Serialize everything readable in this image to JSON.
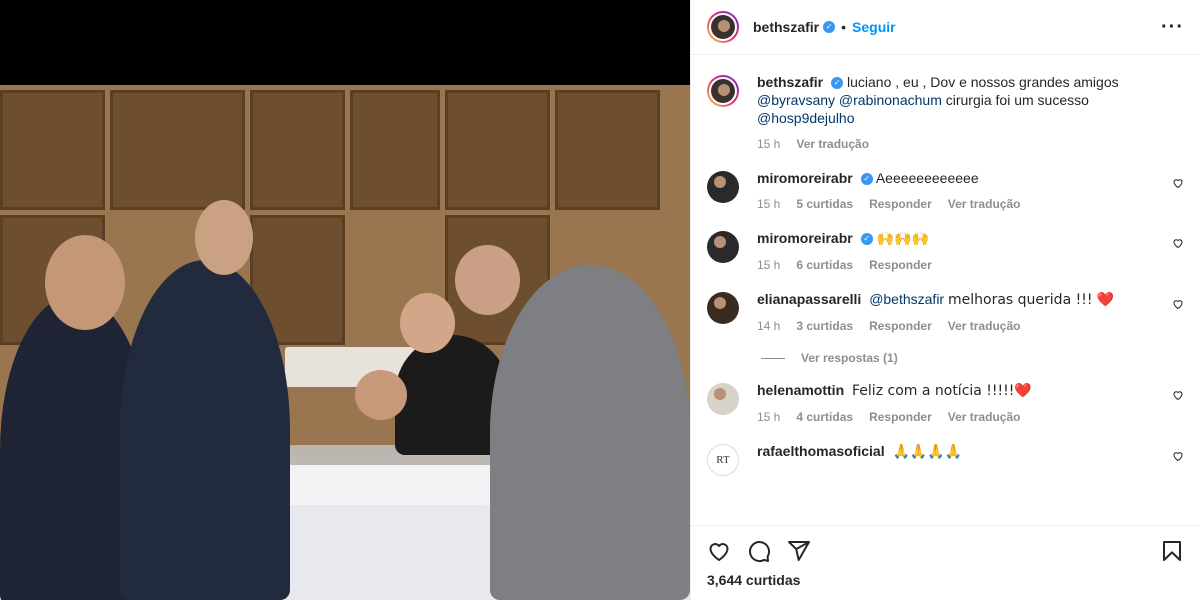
{
  "post": {
    "author": "bethszafir",
    "follow_label": "Seguir",
    "separator": "•",
    "more_label": "···",
    "caption": {
      "username": "bethszafir",
      "text_1": "luciano , eu , Dov e nossos grandes amigos",
      "mention_1": "@byravsany",
      "mention_2": "@rabinonachum",
      "text_2": "cirurgia foi um sucesso",
      "mention_3": "@hosp9dejulho",
      "time": "15 h",
      "translate": "Ver tradução"
    },
    "comments": [
      {
        "username": "miromoreirabr",
        "text": "Aeeeeeeeeeeee",
        "time": "15 h",
        "likes": "5 curtidas",
        "reply": "Responder",
        "translate": "Ver tradução"
      },
      {
        "username": "miromoreirabr",
        "text": "🙌🙌🙌",
        "time": "15 h",
        "likes": "6 curtidas",
        "reply": "Responder"
      },
      {
        "username": "elianapassarelli",
        "mention": "@bethszafir",
        "text": "melhoras querida !!! ❤️",
        "time": "14 h",
        "likes": "3 curtidas",
        "reply": "Responder",
        "translate": "Ver tradução",
        "view_replies": "Ver respostas (1)"
      },
      {
        "username": "helenamottin",
        "text": "Feliz com a notícia !!!!!❤️",
        "time": "15 h",
        "likes": "4 curtidas",
        "reply": "Responder",
        "translate": "Ver tradução"
      },
      {
        "username": "rafaelthomasoficial",
        "text": "🙏🙏🙏🙏",
        "avatar_text": "RT"
      }
    ],
    "likes_count": "3,644 curtidas"
  },
  "colors": {
    "accent": "#0095f6",
    "verified": "#3897f0",
    "heart_red": "#ed4956"
  },
  "icons": [
    "heart-icon",
    "comment-icon",
    "share-icon",
    "bookmark-icon",
    "more-icon"
  ]
}
